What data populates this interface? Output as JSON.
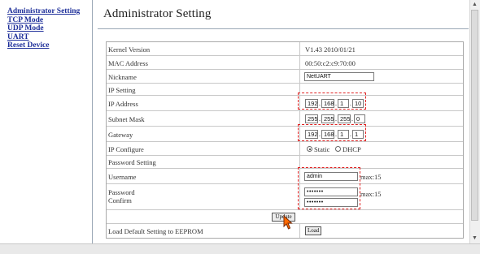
{
  "nav": {
    "items": [
      {
        "label": "Administrator Setting"
      },
      {
        "label": "TCP Mode"
      },
      {
        "label": "UDP Mode"
      },
      {
        "label": "UART"
      },
      {
        "label": "Reset Device"
      }
    ]
  },
  "main": {
    "title": "Administrator Setting"
  },
  "settings": {
    "kernel_label": "Kernel Version",
    "kernel_value": "V1.43 2010/01/21",
    "mac_label": "MAC Address",
    "mac_value": "00:50:c2:c9:70:00",
    "nickname_label": "Nickname",
    "nickname_value": "NetUART",
    "ip_setting_label": "IP Setting",
    "ip_label": "IP Address",
    "ip": [
      "192",
      "168",
      "1",
      "10"
    ],
    "subnet_label": "Subnet Mask",
    "subnet": [
      "255",
      "255",
      "255",
      "0"
    ],
    "gateway_label": "Gateway",
    "gateway": [
      "192",
      "168",
      "1",
      "1"
    ],
    "ipconf_label": "IP Configure",
    "static_label": "Static",
    "dhcp_label": "DHCP",
    "password_setting_label": "Password Setting",
    "username_label": "Username",
    "username_value": "admin",
    "username_max": "max:15",
    "password_label": "Password",
    "confirm_label": "Confirm",
    "password_value": "•••••••",
    "confirm_value": "•••••••",
    "password_max": "max:15",
    "update_label": "Update",
    "load_default_label": "Load Default Setting to EEPROM",
    "load_label": "Load"
  },
  "colors": {
    "highlight": "#e02020",
    "nav_link": "#1e2f9a"
  }
}
